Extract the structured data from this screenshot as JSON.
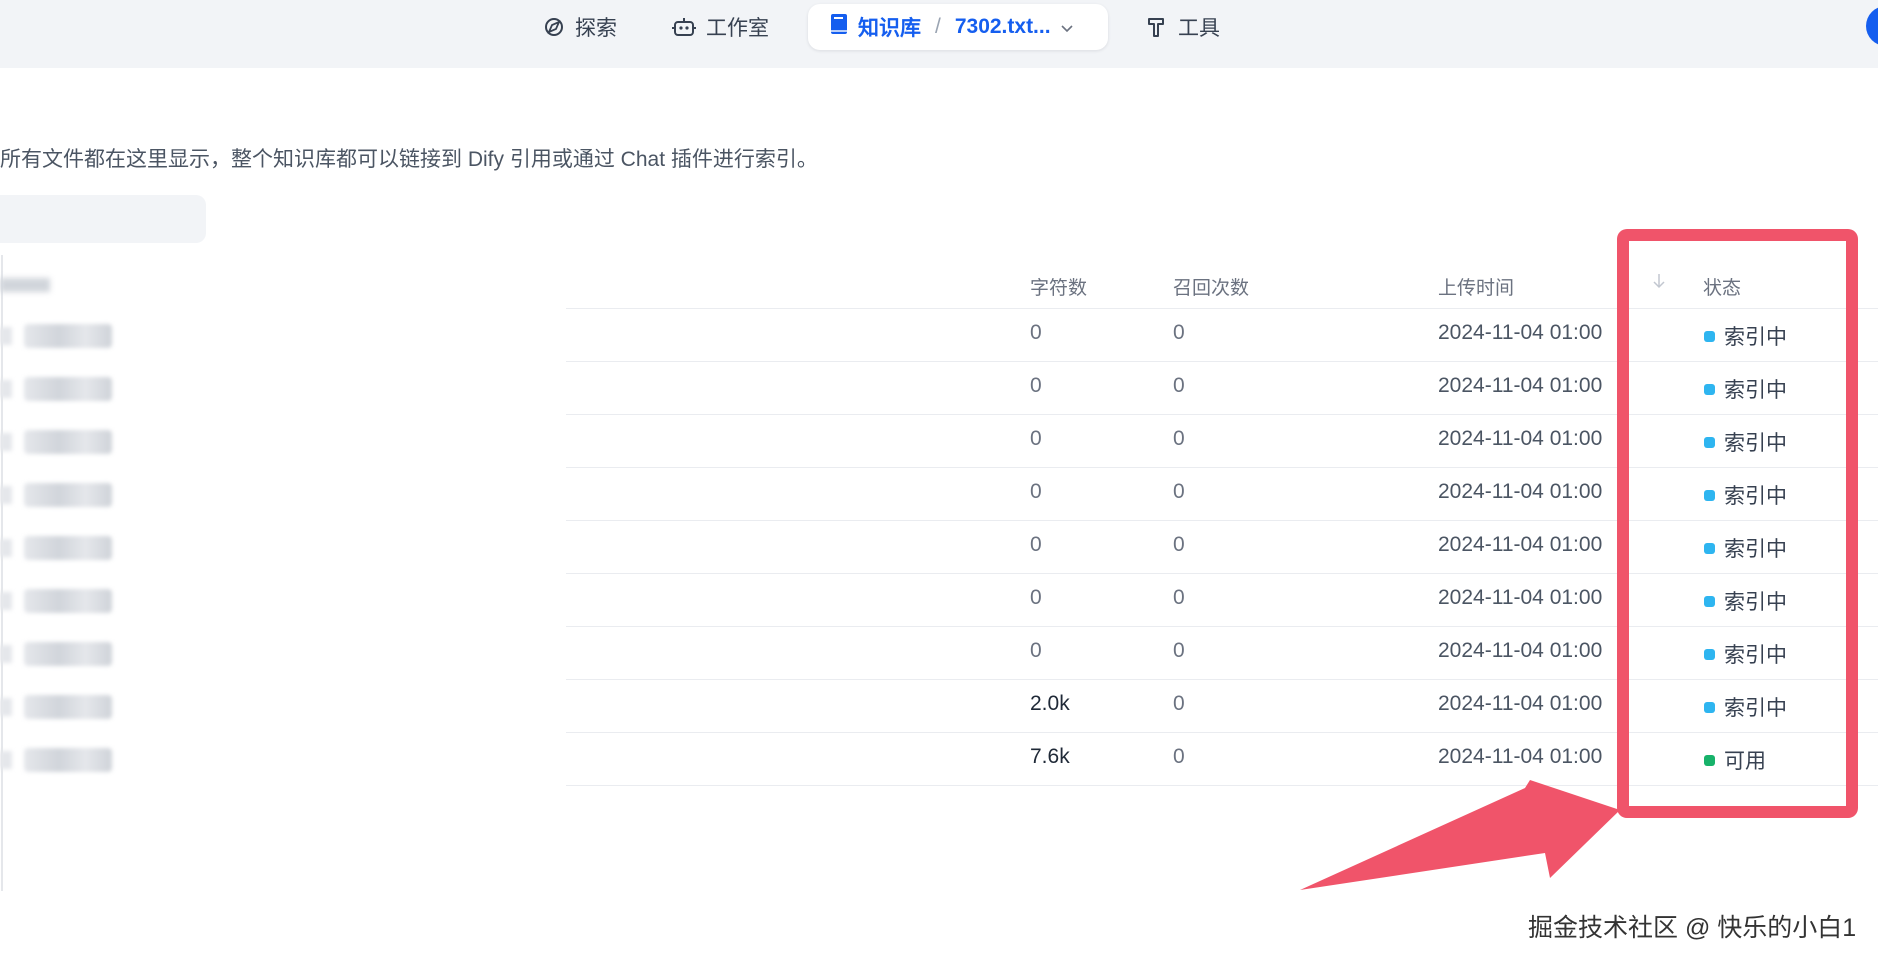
{
  "nav": {
    "explore_label": "探索",
    "studio_label": "工作室",
    "knowledge_label": "知识库",
    "dataset_name": "7302.txt...",
    "breadcrumb_separator": "/",
    "tools_label": "工具"
  },
  "description": "所有文件都在这里显示，整个知识库都可以链接到 Dify 引用或通过 Chat 插件进行索引。",
  "table": {
    "headers": {
      "words": "字符数",
      "recall": "召回次数",
      "upload_time": "上传时间",
      "status": "状态"
    },
    "sort_icon": "arrow-down-icon",
    "rows": [
      {
        "words": "0",
        "recall": "0",
        "time": "2024-11-04 01:00",
        "status": "索引中",
        "status_color": "#2eb5f0"
      },
      {
        "words": "0",
        "recall": "0",
        "time": "2024-11-04 01:00",
        "status": "索引中",
        "status_color": "#2eb5f0"
      },
      {
        "words": "0",
        "recall": "0",
        "time": "2024-11-04 01:00",
        "status": "索引中",
        "status_color": "#2eb5f0"
      },
      {
        "words": "0",
        "recall": "0",
        "time": "2024-11-04 01:00",
        "status": "索引中",
        "status_color": "#2eb5f0"
      },
      {
        "words": "0",
        "recall": "0",
        "time": "2024-11-04 01:00",
        "status": "索引中",
        "status_color": "#2eb5f0"
      },
      {
        "words": "0",
        "recall": "0",
        "time": "2024-11-04 01:00",
        "status": "索引中",
        "status_color": "#2eb5f0"
      },
      {
        "words": "0",
        "recall": "0",
        "time": "2024-11-04 01:00",
        "status": "索引中",
        "status_color": "#2eb5f0"
      },
      {
        "words": "2.0k",
        "recall": "0",
        "time": "2024-11-04 01:00",
        "status": "索引中",
        "status_color": "#2eb5f0"
      },
      {
        "words": "7.6k",
        "recall": "0",
        "time": "2024-11-04 01:00",
        "status": "可用",
        "status_color": "#17b26a"
      }
    ]
  },
  "annotation_color": "#f0546a",
  "watermark": "掘金技术社区 @ 快乐的小白1"
}
